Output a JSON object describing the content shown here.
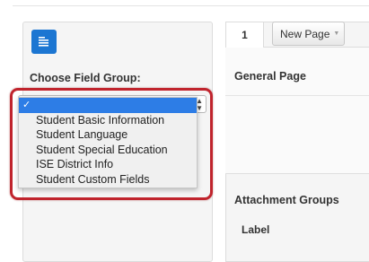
{
  "field_group": {
    "label": "Choose Field Group:",
    "selected_value": "",
    "options": [
      {
        "label": "✓",
        "selected": true
      },
      {
        "label": "Student Basic Information",
        "selected": false
      },
      {
        "label": "Student Language",
        "selected": false
      },
      {
        "label": "Student Special Education",
        "selected": false
      },
      {
        "label": "ISE District Info",
        "selected": false
      },
      {
        "label": "Student Custom Fields",
        "selected": false
      }
    ]
  },
  "tabs": {
    "active_tab_label": "1",
    "new_page_label": "New Page"
  },
  "main": {
    "general_page_label": "General Page",
    "attachment_groups_label": "Attachment Groups",
    "label_column": "Label"
  },
  "icons": {
    "menu": "hamburger-menu-icon",
    "dropdown_caret": "caret-down-icon",
    "select_arrows": "select-up-down-arrows-icon"
  },
  "colors": {
    "accent_blue": "#1c76d2",
    "selection_blue": "#2d7de6",
    "annotation_red": "#c0242d"
  }
}
